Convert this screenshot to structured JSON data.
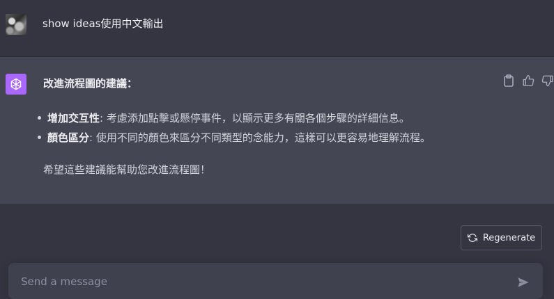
{
  "user_message": {
    "text": "show ideas使用中文輸出"
  },
  "assistant_message": {
    "heading": "改進流程圖的建議：",
    "bullets": [
      {
        "title": "增加交互性",
        "body": ": 考慮添加點擊或懸停事件，以顯示更多有關各個步驟的詳細信息。"
      },
      {
        "title": "顏色區分",
        "body": ": 使用不同的顏色來區分不同類型的念能力，這樣可以更容易地理解流程。"
      }
    ],
    "closing": "希望這些建議能幫助您改進流程圖！",
    "actions": [
      "clipboard-icon",
      "thumbs-up-icon",
      "thumbs-down-icon"
    ]
  },
  "regenerate": {
    "label": "Regenerate",
    "icon": "refresh-icon"
  },
  "composer": {
    "placeholder": "Send a message",
    "send_icon": "send-icon"
  },
  "colors": {
    "background": "#343541",
    "assistant_background": "#444654",
    "accent": "#ab68ff",
    "input_background": "#40414f"
  }
}
